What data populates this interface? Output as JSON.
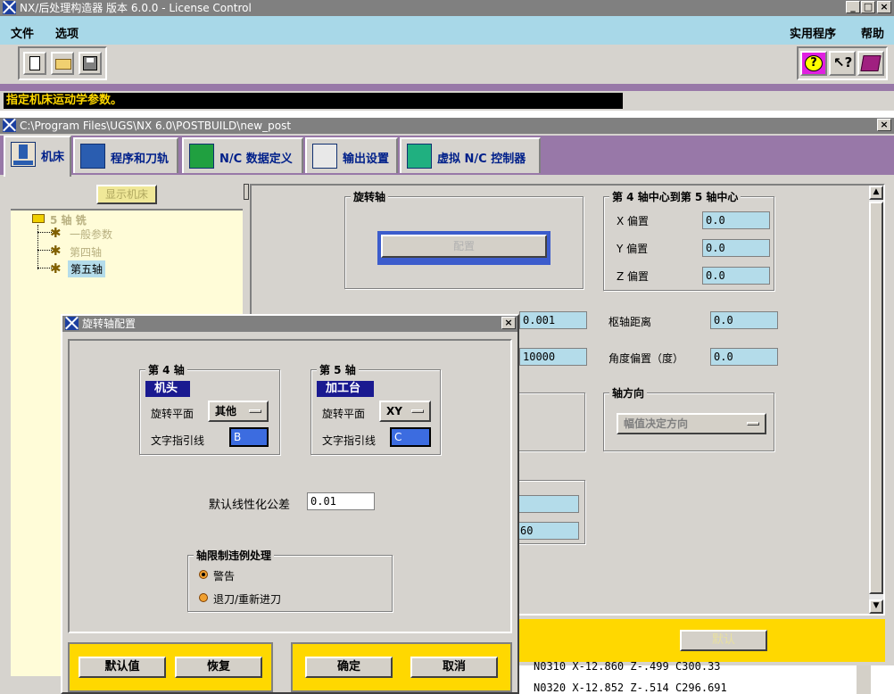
{
  "app": {
    "title": "NX/后处理构造器 版本 6.0.0 - License Control"
  },
  "menu": {
    "file": "文件",
    "options": "选项",
    "utilities": "实用程序",
    "help": "帮助"
  },
  "icons": {
    "new": "new-file-icon",
    "open": "open-folder-icon",
    "save": "save-disk-icon",
    "help": "question-icon",
    "context_help": "pointer-help-icon",
    "manual": "book-icon"
  },
  "status": {
    "text": "指定机床运动学参数。"
  },
  "post_window": {
    "title": "C:\\Program Files\\UGS\\NX 6.0\\POSTBUILD\\new_post"
  },
  "tabs": [
    {
      "label": "机床"
    },
    {
      "label": "程序和刀轨"
    },
    {
      "label": "N/C 数据定义"
    },
    {
      "label": "输出设置"
    },
    {
      "label": "虚拟 N/C 控制器"
    }
  ],
  "tree": {
    "display_button": "显示机床",
    "root": "5 轴 铣",
    "items": [
      "一般参数",
      "第四轴",
      "第五轴"
    ]
  },
  "rotary": {
    "group_title": "旋转轴",
    "config_button": "配置"
  },
  "center": {
    "group_title": "第 4 轴中心到第 5 轴中心",
    "x_label": "X 偏置",
    "x_value": "0.0",
    "y_label": "Y 偏置",
    "y_value": "0.0",
    "z_label": "Z 偏置",
    "z_value": "0.0"
  },
  "params": {
    "resolution_value": "0.001",
    "pivot_label": "枢轴距离",
    "pivot_value": "0.0",
    "feed_value": "10000",
    "angle_label": "角度偏置（度）",
    "angle_value": "0.0",
    "limit_value": "60"
  },
  "direction": {
    "group_title": "轴方向",
    "value": "幅值决定方向"
  },
  "bottom": {
    "default_button": "默认"
  },
  "nc_lines": [
    "N0310 X-12.860 Z-.499 C300.33",
    "N0320 X-12.852 Z-.514 C296.691"
  ],
  "dialog": {
    "title": "旋转轴配置",
    "axis4": {
      "title": "第 4 轴",
      "tag": "机头",
      "plane_label": "旋转平面",
      "plane_value": "其他",
      "leader_label": "文字指引线",
      "leader_value": "B"
    },
    "axis5": {
      "title": "第 5 轴",
      "tag": "加工台",
      "plane_label": "旋转平面",
      "plane_value": "XY",
      "leader_label": "文字指引线",
      "leader_value": "C"
    },
    "tolerance_label": "默认线性化公差",
    "tolerance_value": "0.01",
    "limit": {
      "title": "轴限制违例处理",
      "warning": "警告",
      "retract": "退刀/重新进刀"
    },
    "buttons": {
      "default": "默认值",
      "restore": "恢复",
      "ok": "确定",
      "cancel": "取消"
    }
  },
  "colors": {
    "menu_bg": "#a8d8e8",
    "tab_bar": "#9878a8",
    "dialog_bg": "#d6d3ce",
    "yellow_bar": "#ffd800",
    "field": "#b4dcea"
  }
}
